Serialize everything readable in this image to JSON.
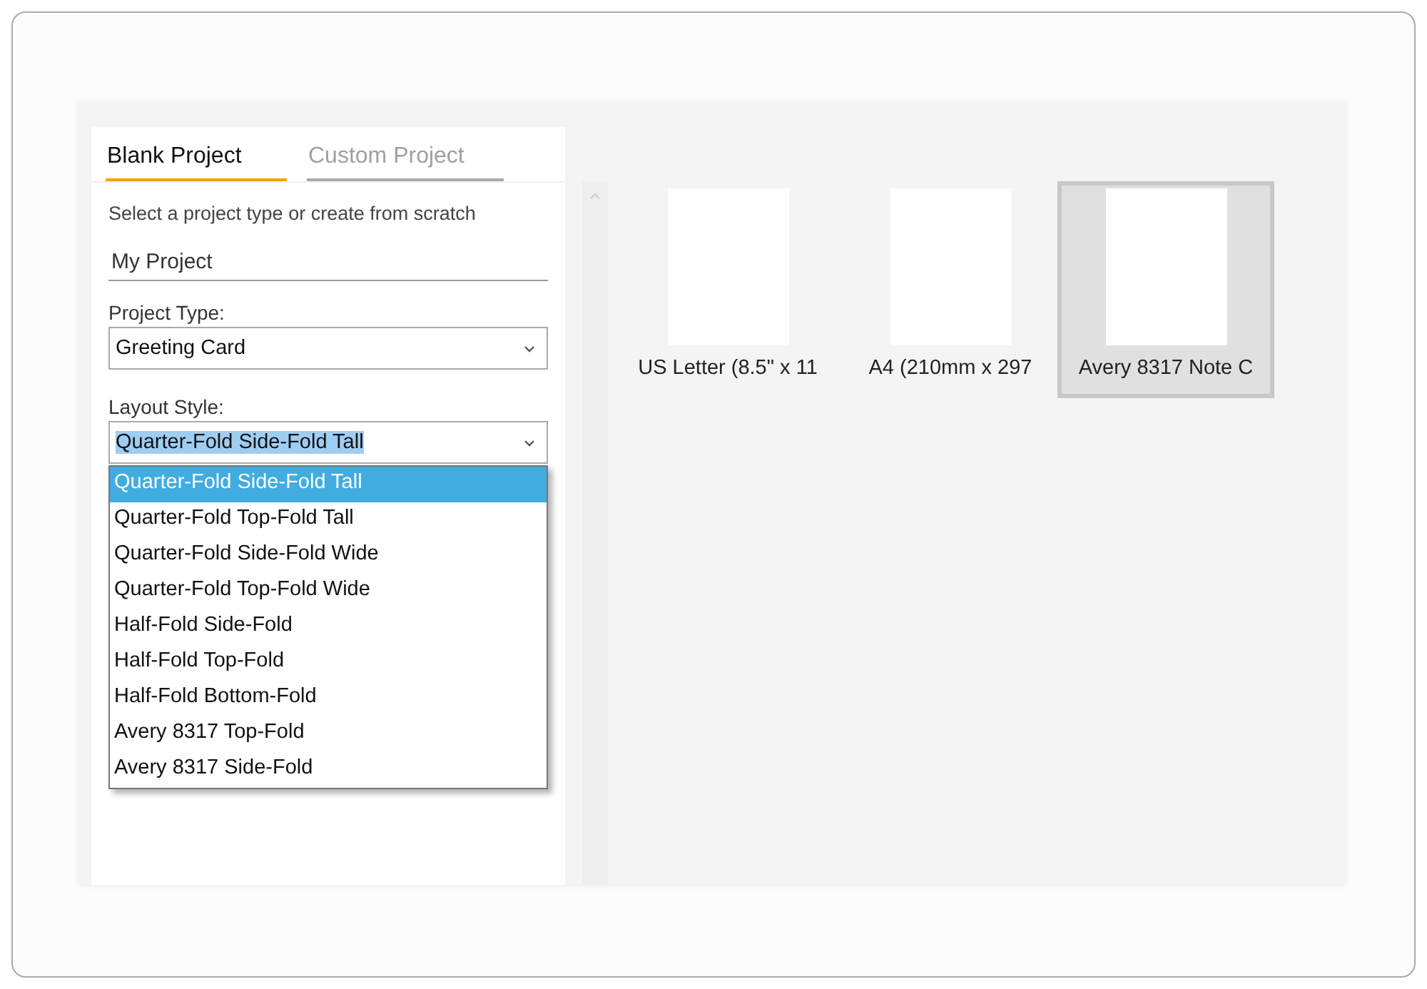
{
  "tabs": [
    {
      "label": "Blank Project",
      "selected": true
    },
    {
      "label": "Custom Project",
      "selected": false
    }
  ],
  "instructions": "Select a project type or create from scratch",
  "name_field": {
    "value": "My Project"
  },
  "project_type": {
    "label": "Project Type:",
    "value": "Greeting Card"
  },
  "layout_style": {
    "label": "Layout Style:",
    "value": "Quarter-Fold Side-Fold Tall",
    "expanded": true,
    "options": [
      {
        "label": "Quarter-Fold Side-Fold Tall",
        "selected": true
      },
      {
        "label": "Quarter-Fold Top-Fold Tall",
        "selected": false
      },
      {
        "label": "Quarter-Fold Side-Fold Wide",
        "selected": false
      },
      {
        "label": "Quarter-Fold Top-Fold Wide",
        "selected": false
      },
      {
        "label": "Half-Fold Side-Fold",
        "selected": false
      },
      {
        "label": "Half-Fold Top-Fold",
        "selected": false
      },
      {
        "label": "Half-Fold Bottom-Fold",
        "selected": false
      },
      {
        "label": "Avery 8317 Top-Fold",
        "selected": false
      },
      {
        "label": "Avery 8317 Side-Fold",
        "selected": false
      }
    ]
  },
  "paper_sizes": [
    {
      "label": "US Letter (8.5\" x 11",
      "selected": false
    },
    {
      "label": "A4 (210mm x 297",
      "selected": false
    },
    {
      "label": "Avery 8317 Note C",
      "selected": true
    }
  ]
}
